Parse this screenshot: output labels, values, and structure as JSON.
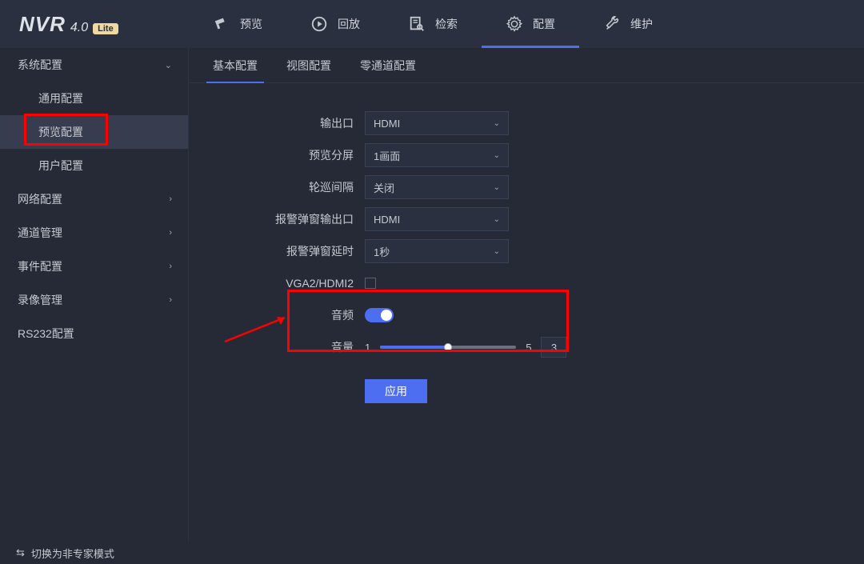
{
  "header": {
    "brand": "NVR",
    "version": "4.0",
    "edition": "Lite",
    "nav": [
      {
        "key": "preview",
        "label": "预览"
      },
      {
        "key": "playback",
        "label": "回放"
      },
      {
        "key": "search",
        "label": "检索"
      },
      {
        "key": "config",
        "label": "配置",
        "active": true
      },
      {
        "key": "maintain",
        "label": "维护"
      }
    ]
  },
  "sidebar": {
    "groups": [
      {
        "key": "system",
        "label": "系统配置",
        "expanded": true,
        "children": [
          {
            "key": "general",
            "label": "通用配置"
          },
          {
            "key": "preview",
            "label": "预览配置",
            "active": true,
            "highlighted": true
          },
          {
            "key": "user",
            "label": "用户配置"
          }
        ]
      },
      {
        "key": "network",
        "label": "网络配置"
      },
      {
        "key": "channel",
        "label": "通道管理"
      },
      {
        "key": "event",
        "label": "事件配置"
      },
      {
        "key": "record",
        "label": "录像管理"
      },
      {
        "key": "rs232",
        "label": "RS232配置"
      }
    ]
  },
  "tabs": [
    {
      "key": "basic",
      "label": "基本配置",
      "active": true
    },
    {
      "key": "view",
      "label": "视图配置"
    },
    {
      "key": "zerochan",
      "label": "零通道配置"
    }
  ],
  "form": {
    "output": {
      "label": "输出口",
      "value": "HDMI"
    },
    "split": {
      "label": "预览分屏",
      "value": "1画面"
    },
    "patrol": {
      "label": "轮巡间隔",
      "value": "关闭"
    },
    "alarm_out": {
      "label": "报警弹窗输出口",
      "value": "HDMI"
    },
    "alarm_delay": {
      "label": "报警弹窗延时",
      "value": "1秒"
    },
    "vga2hdmi2": {
      "label": "VGA2/HDMI2",
      "checked": false
    },
    "audio": {
      "label": "音频",
      "on": true
    },
    "volume": {
      "label": "音量",
      "min": "1",
      "max": "5",
      "value": "3"
    },
    "apply": "应用"
  },
  "footer": {
    "switch_mode": "切换为非专家模式"
  },
  "colors": {
    "accent": "#4d6ef0",
    "highlight": "#ff0000"
  }
}
